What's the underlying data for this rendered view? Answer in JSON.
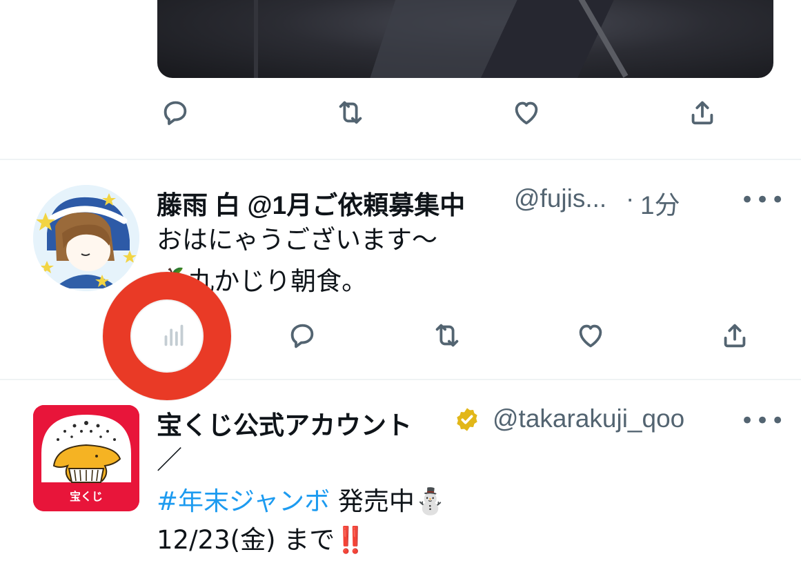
{
  "tweet_top": {
    "actions": {
      "reply_icon": "reply-icon",
      "retweet_icon": "retweet-icon",
      "like_icon": "like-icon",
      "share_icon": "share-icon"
    }
  },
  "tweet1": {
    "display_name": "藤雨 白 @1月ご依頼募集中",
    "handle": "@fujis...",
    "separator": "·",
    "time": "1分",
    "more": "•••",
    "lines": [
      "おはにゃうございます〜",
      "丸かじり朝食。"
    ],
    "emoji": "🍏",
    "actions": {
      "analytics_icon": "analytics-icon",
      "reply_icon": "reply-icon",
      "retweet_icon": "retweet-icon",
      "like_icon": "like-icon",
      "share_icon": "share-icon"
    }
  },
  "tweet2": {
    "display_name": "宝くじ公式アカウント",
    "handle": "@takarakuji_qoo",
    "more": "•••",
    "avatar_label": "宝くじ",
    "line1": "／",
    "hashtag": "#年末ジャンボ",
    "line2_rest": " 発売中",
    "snowman": "⛄",
    "line3": "12/23(金) まで",
    "exclaim": "‼️"
  },
  "colors": {
    "accent": "#1d9bf0",
    "gold": "#e2b719",
    "overlay_ring": "#e93a26",
    "lottery_red": "#e8153a",
    "icon_gray": "#536471"
  }
}
